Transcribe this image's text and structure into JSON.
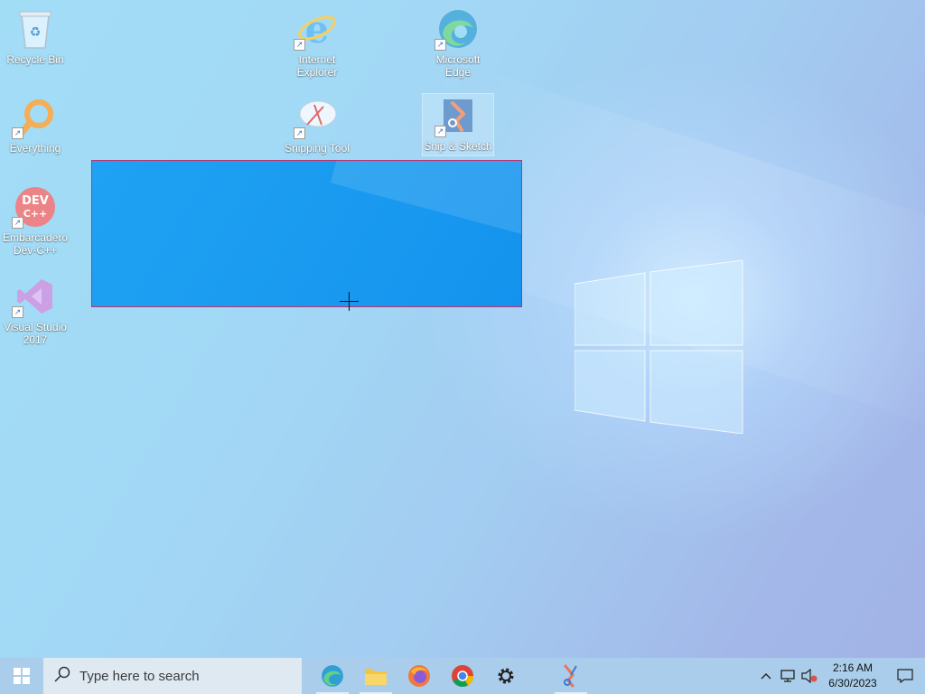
{
  "desktop": {
    "icons": [
      {
        "label": "Recycle Bin",
        "icon": "recycle-bin-icon"
      },
      {
        "label": "Everything",
        "icon": "everything-search-icon"
      },
      {
        "label": "Embarcadero Dev-C++",
        "icon": "dev-cpp-icon",
        "badge": "DEV C++"
      },
      {
        "label": "Visual Studio 2017",
        "icon": "visual-studio-icon"
      },
      {
        "label": "Internet Explorer",
        "icon": "internet-explorer-icon"
      },
      {
        "label": "Snipping Tool",
        "icon": "snipping-tool-icon"
      },
      {
        "label": "Microsoft Edge",
        "icon": "edge-icon"
      },
      {
        "label": "Snip & Sketch",
        "icon": "snip-sketch-icon"
      }
    ]
  },
  "taskbar": {
    "search_placeholder": "Type here to search",
    "apps": [
      {
        "name": "Microsoft Edge",
        "icon": "edge-icon",
        "running": true
      },
      {
        "name": "File Explorer",
        "icon": "folder-icon",
        "running": true
      },
      {
        "name": "Firefox",
        "icon": "firefox-icon",
        "running": false
      },
      {
        "name": "Google Chrome",
        "icon": "chrome-icon",
        "running": false
      },
      {
        "name": "Settings",
        "icon": "gear-icon",
        "running": false
      },
      {
        "name": "Snip & Sketch",
        "icon": "snip-sketch-icon",
        "running": true
      }
    ],
    "clock": {
      "time": "2:16 AM",
      "date": "6/30/2023"
    }
  },
  "colors": {
    "selection_border": "#c0306a",
    "selection_fill": "#1a9bf0",
    "taskbar": "#a9cdea"
  }
}
